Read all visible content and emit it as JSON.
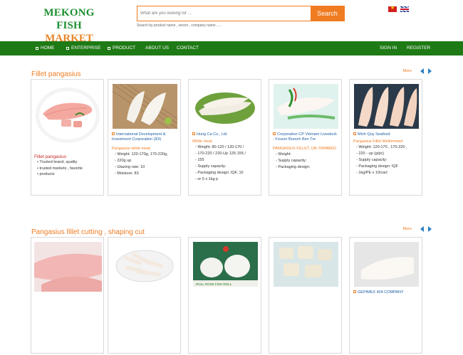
{
  "logo": {
    "line1": "MEKONG FISH",
    "line2": "MARKET"
  },
  "search": {
    "placeholder": "What are you looking for ...",
    "button": "Search",
    "hint": "Search by product name , sector , company name , ..."
  },
  "languages": [
    "vietnam-flag",
    "uk-flag"
  ],
  "nav": {
    "left": [
      "HOME",
      "ENTERPRISE",
      "PRODUCT",
      "ABOUT US",
      "CONTACT"
    ],
    "right": [
      "SIGN IN",
      "REGISTER"
    ]
  },
  "colors": {
    "brand_green": "#1e7a15",
    "accent_orange": "#f07c22",
    "link_blue": "#1e5fa6"
  },
  "section1": {
    "title": "Fillet pangasius",
    "more": "More",
    "intro": {
      "name": "Fillet pangasius",
      "bullets": [
        "Trusted brand, quality",
        "trusted markets , favorite",
        "products"
      ]
    },
    "cards": [
      {
        "company": "International Development & Investment Corporation (IDI)",
        "product": "Pangasius white meat",
        "specs": [
          "Weight:  120-170g, 170-220g,",
          "220g up",
          "Glazing rate: 10",
          "Moisture: 83"
        ]
      },
      {
        "company": "Hung Ca Co., Ltd",
        "product": "White meat",
        "specs": [
          "Weight:  80-120 / 120-170 /",
          "170-220 / 220-Up 125-155 /",
          "155",
          "Supply capacity:",
          "Packaging design: IQF, 10",
          "or 5 x 1kg p"
        ]
      },
      {
        "company": "Corporation CP Vietnam Livestock - Frozen Branch Ben Tre",
        "product": "PANGASIUS FILLET, UN-TRIMMED",
        "specs": [
          "Weight:",
          "Supply capacity:",
          "Packaging design:"
        ]
      },
      {
        "company": "Minh Quy Seafood",
        "product": "Pangasius Fillet Wellrimmed",
        "specs": [
          "Weight:  120-170 , 170-220 ,",
          "220 - up (g/pc)",
          "Supply capacity:",
          "Packaging design: IQF",
          "1kg/PE x 10/cart"
        ]
      }
    ]
  },
  "section2": {
    "title": "Pangasius fillet cutting , shaping cut",
    "more": "More",
    "cards": [
      {
        "company": ""
      },
      {
        "company": ""
      },
      {
        "company": ""
      },
      {
        "company": ""
      },
      {
        "company": "GEPIMEX 404 COMPANY"
      }
    ],
    "image_labels": {
      "rolls": "ROLL ROSE FISH ROLL"
    }
  }
}
